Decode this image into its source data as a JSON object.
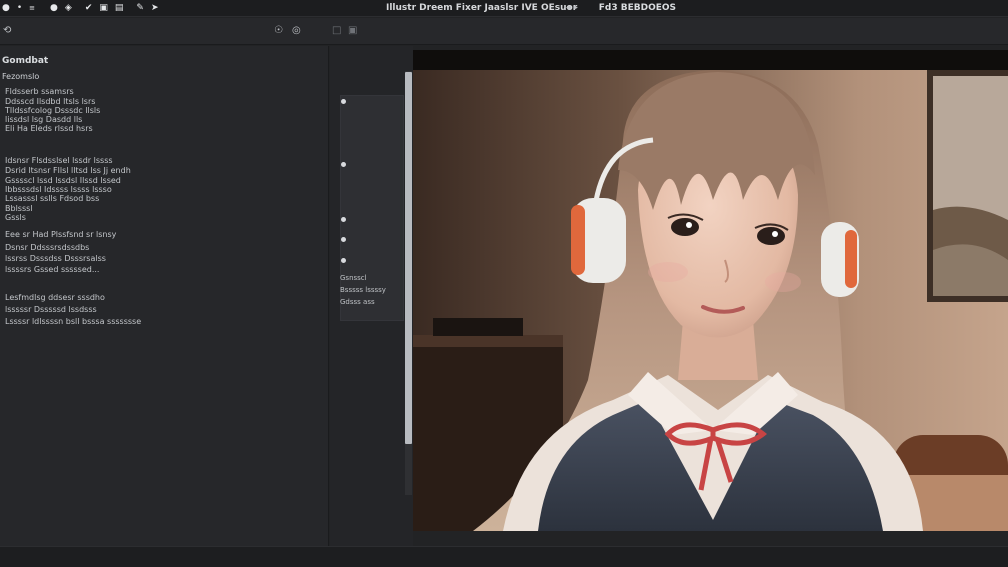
{
  "titlebar": {
    "title": "Illustr Dreem Fixer Jaaslsr IVE OEsuor",
    "title_right_a": "◂   ▸",
    "title_right_b": "Fd3 BEBDOEOS",
    "icons": [
      "app-icon",
      "dot-icon",
      "nav-icon",
      "circle-icon",
      "shield-icon",
      "check-icon",
      "document-icon",
      "layers-icon",
      "edit-icon",
      "pointer-icon"
    ]
  },
  "toolbar": {
    "left_icon": "⟲",
    "icon_a": "☉",
    "icon_b": "◎",
    "icon_c": "□",
    "icon_d": "▣"
  },
  "leftpane": {
    "header": "Gomdbat",
    "sub": "Fezomslo",
    "lines": [
      "Fldsserb  ssamsrs",
      "Ddsscd  Ilsdbd  ltsls  lsrs",
      "Tlldssfcolog  Dsssdc  llsls",
      "lissdsl lsg  Dasdd  lls",
      "Eli Ha  Eleds  rlssd  hsrs",
      "Idsnsr  Flsdsslsel lssdr lssss",
      "Dsrid  ltsnsr Fllsl  lltsd  lss  Jj  endh",
      "Gsssscl  lssd  lssdsl  Ilssd  lssed",
      "Ibbsssdsl  Idssss  lssss  lssso",
      "Lssasssl  sslls  Fdsod  bss",
      "Bblsssl",
      "Gssls",
      "Eee sr  Had Plssfsnd  sr  lsnsy",
      "Dsnsr  Ddsssrsdssdbs",
      "lssrss  Dsssdss  Dsssrsalss",
      "lssssrs  Gssed  sssssed...",
      "Lesfmdlsg  ddsesr  sssdho",
      "lsssssr  Dsssssd  lssdsss",
      "Lssssr ldlssssn  bsll  bsssa  ssssssse"
    ]
  },
  "midpane": {
    "caption_1": "Gsnsscl",
    "caption_2": "Bsssss  lssssy",
    "caption_3": "Gdsss  ass"
  },
  "preview": {
    "palette": {
      "wall": "#a88a75",
      "hair": "#b09079",
      "skin": "#e8c2ae",
      "vest": "#3c4452",
      "ribbon": "#c84444",
      "headphone_accent": "#e0683c"
    }
  }
}
